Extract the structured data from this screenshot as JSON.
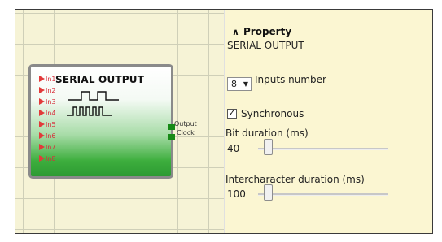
{
  "block": {
    "title": "SERIAL OUTPUT",
    "inputs": [
      "In1",
      "In2",
      "In3",
      "In4",
      "In5",
      "In6",
      "In7",
      "In8"
    ],
    "outputs": [
      "Output",
      "Clock"
    ]
  },
  "property": {
    "header": "Property",
    "subheader": "SERIAL OUTPUT",
    "inputs_number": {
      "value": "8",
      "label": "Inputs number"
    },
    "synchronous": {
      "label": "Synchronous",
      "checked": true,
      "check_mark": "✓"
    },
    "bit_duration": {
      "label": "Bit duration (ms)",
      "value": "40",
      "level": 0.05
    },
    "intercharacter_duration": {
      "label": "Intercharacter duration (ms)",
      "value": "100",
      "level": 0.05
    }
  }
}
